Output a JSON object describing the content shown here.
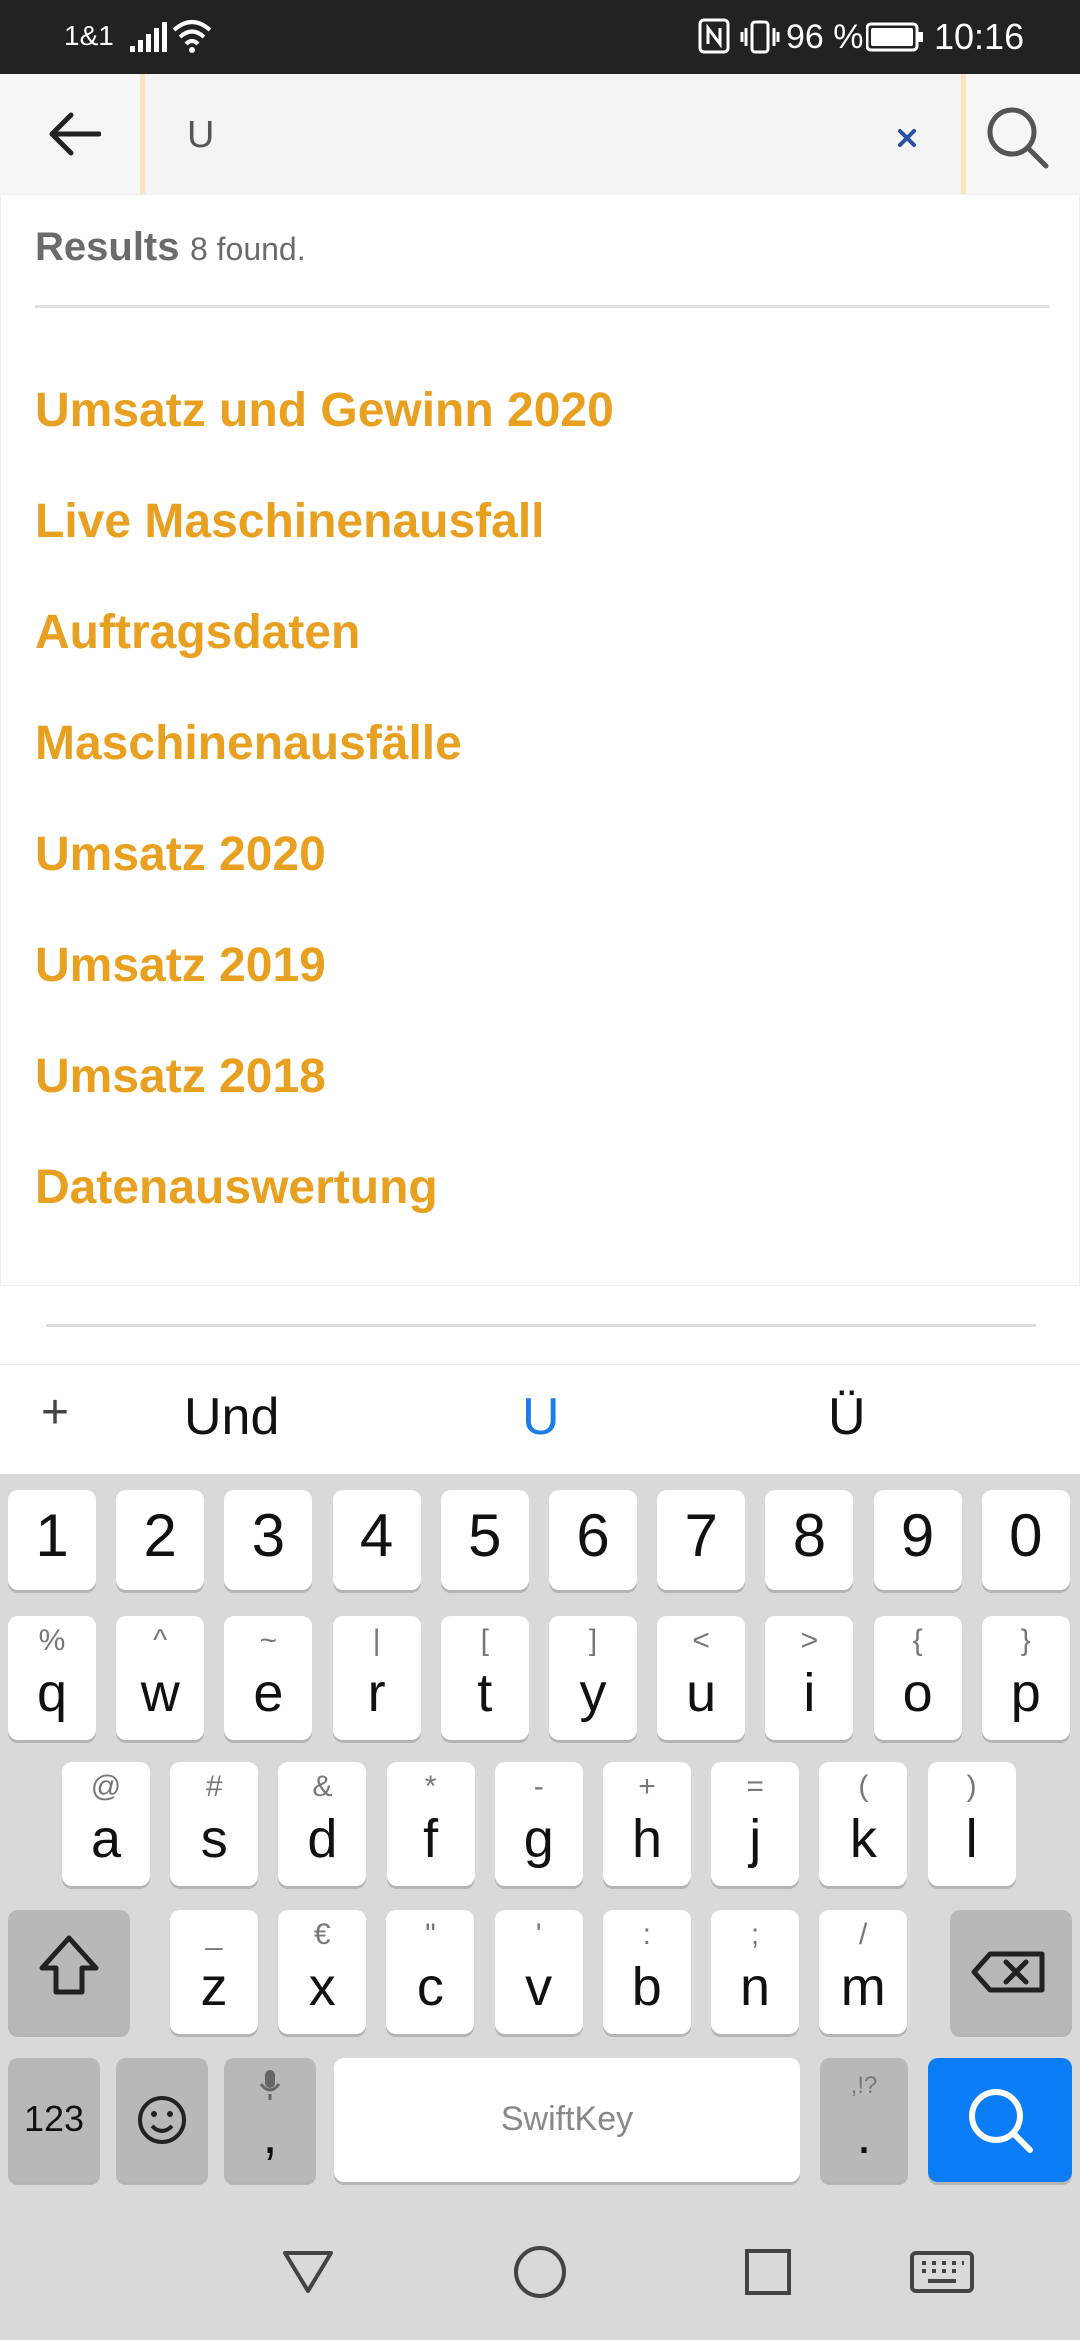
{
  "status_bar": {
    "carrier": "1&1",
    "battery_percent": "96 %",
    "time": "10:16",
    "icons": [
      "signal-icon",
      "wifi-icon",
      "nfc-icon",
      "vibrate-icon",
      "battery-icon"
    ]
  },
  "search": {
    "value": "U",
    "placeholder": "",
    "clear_icon": "close-icon",
    "submit_icon": "search-icon",
    "back_icon": "arrow-left-icon"
  },
  "results": {
    "title": "Results",
    "count_text": "8 found.",
    "items": [
      "Umsatz und Gewinn 2020",
      "Live Maschinenausfall",
      "Auftragsdaten",
      "Maschinenausfälle",
      "Umsatz 2020",
      "Umsatz 2019",
      "Umsatz 2018",
      "Datenauswertung"
    ]
  },
  "keyboard": {
    "suggestions": {
      "plus": "+",
      "s1": "Und",
      "s2": "U",
      "s3": "Ü"
    },
    "row_numbers": [
      "1",
      "2",
      "3",
      "4",
      "5",
      "6",
      "7",
      "8",
      "9",
      "0"
    ],
    "row1": [
      {
        "main": "q",
        "alt": "%"
      },
      {
        "main": "w",
        "alt": "^"
      },
      {
        "main": "e",
        "alt": "~"
      },
      {
        "main": "r",
        "alt": "|"
      },
      {
        "main": "t",
        "alt": "["
      },
      {
        "main": "y",
        "alt": "]"
      },
      {
        "main": "u",
        "alt": "<"
      },
      {
        "main": "i",
        "alt": ">"
      },
      {
        "main": "o",
        "alt": "{"
      },
      {
        "main": "p",
        "alt": "}"
      }
    ],
    "row2": [
      {
        "main": "a",
        "alt": "@"
      },
      {
        "main": "s",
        "alt": "#"
      },
      {
        "main": "d",
        "alt": "&"
      },
      {
        "main": "f",
        "alt": "*"
      },
      {
        "main": "g",
        "alt": "-"
      },
      {
        "main": "h",
        "alt": "+"
      },
      {
        "main": "j",
        "alt": "="
      },
      {
        "main": "k",
        "alt": "("
      },
      {
        "main": "l",
        "alt": ")"
      }
    ],
    "row3": [
      {
        "main": "z",
        "alt": "_"
      },
      {
        "main": "x",
        "alt": "€"
      },
      {
        "main": "c",
        "alt": "\""
      },
      {
        "main": "v",
        "alt": "'"
      },
      {
        "main": "b",
        "alt": ":"
      },
      {
        "main": "n",
        "alt": ";"
      },
      {
        "main": "m",
        "alt": "/"
      }
    ],
    "bottom": {
      "numbers_label": "123",
      "comma_label": ",",
      "space_label": "SwiftKey",
      "period_label": ".",
      "period_alt": ",!?"
    },
    "accent_color": "#0a7cf5"
  },
  "colors": {
    "result_text": "#e8a020",
    "status_bar_bg": "#222222"
  }
}
